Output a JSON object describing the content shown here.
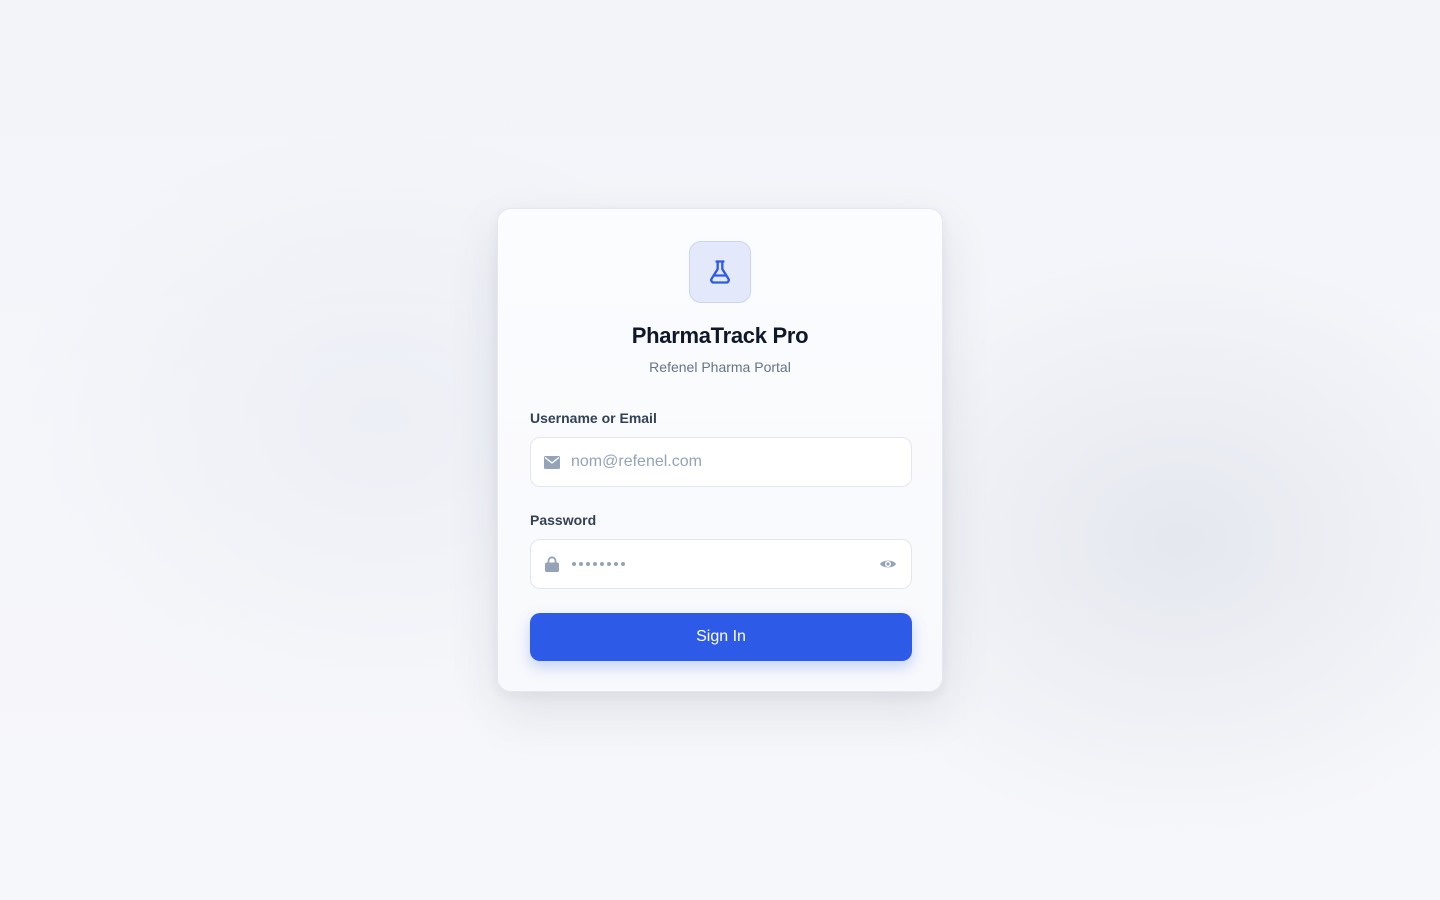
{
  "brand": {
    "logo_icon": "flask-icon",
    "title": "PharmaTrack Pro",
    "subtitle": "Refenel Pharma Portal",
    "accent_color": "#2d5be8"
  },
  "form": {
    "username": {
      "label": "Username or Email",
      "placeholder": "nom@refenel.com",
      "value": "",
      "icon": "envelope-icon"
    },
    "password": {
      "label": "Password",
      "masked_length": 8,
      "icon": "lock-icon",
      "toggle_icon": "eye-icon"
    },
    "submit_label": "Sign In"
  }
}
